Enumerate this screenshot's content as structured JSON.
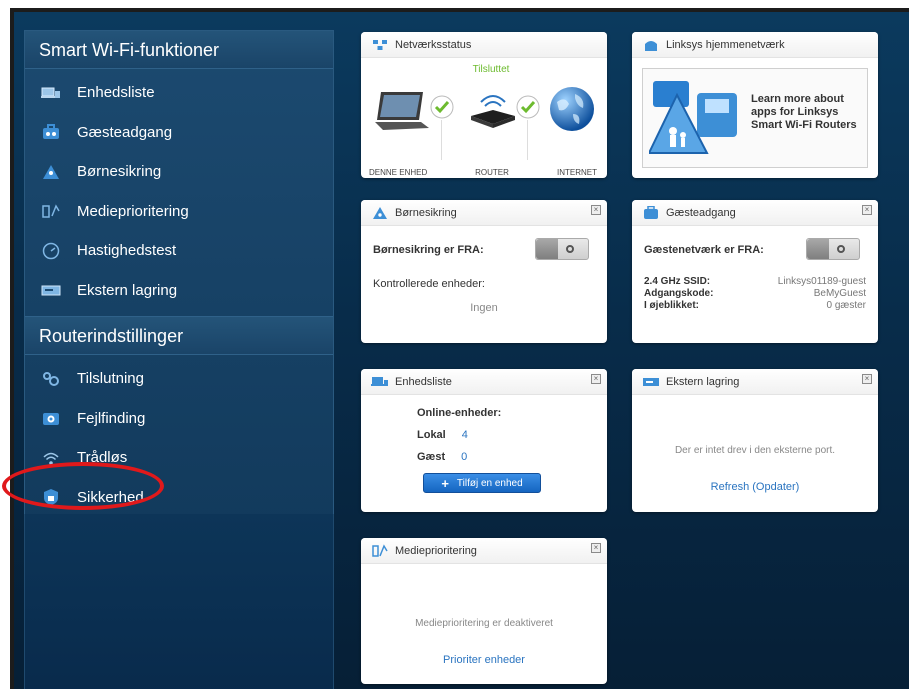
{
  "sidebar": {
    "smart_header": "Smart Wi-Fi-funktioner",
    "smart_items": [
      {
        "label": "Enhedsliste"
      },
      {
        "label": "Gæsteadgang"
      },
      {
        "label": "Børnesikring"
      },
      {
        "label": "Medieprioritering"
      },
      {
        "label": "Hastighedstest"
      },
      {
        "label": "Ekstern lagring"
      }
    ],
    "router_header": "Routerindstillinger",
    "router_items": [
      {
        "label": "Tilslutning"
      },
      {
        "label": "Fejlfinding"
      },
      {
        "label": "Trådløs"
      },
      {
        "label": "Sikkerhed"
      }
    ]
  },
  "network_status": {
    "title": "Netværksstatus",
    "connected_label": "Tilsluttet",
    "device_label": "DENNE ENHED",
    "router_label": "ROUTER",
    "internet_label": "INTERNET"
  },
  "home_network": {
    "title": "Linksys hjemmenetværk",
    "promo_line1": "Learn more about",
    "promo_line2": "apps for Linksys",
    "promo_line3": "Smart Wi-Fi Routers"
  },
  "parental": {
    "title": "Børnesikring",
    "status": "Børnesikring er FRA:",
    "controlled_label": "Kontrollerede enheder:",
    "controlled_value": "Ingen"
  },
  "guest": {
    "title": "Gæsteadgang",
    "status": "Gæstenetværk er FRA:",
    "ssid_label": "2.4 GHz SSID:",
    "ssid_value": "Linksys01189-guest",
    "password_label": "Adgangskode:",
    "password_value": "BeMyGuest",
    "current_label": "I øjeblikket:",
    "current_value": "0 gæster"
  },
  "device_list": {
    "title": "Enhedsliste",
    "online_label": "Online-enheder:",
    "local_label": "Lokal",
    "local_value": "4",
    "guest_label": "Gæst",
    "guest_value": "0",
    "add_button": "Tilføj en enhed"
  },
  "storage": {
    "title": "Ekstern lagring",
    "message": "Der er intet drev i den eksterne port.",
    "refresh": "Refresh (Opdater)"
  },
  "media": {
    "title": "Medieprioritering",
    "message": "Medieprioritering er deaktiveret",
    "link": "Prioriter enheder"
  },
  "colors": {
    "accent_green": "#6dbb2f",
    "link_blue": "#2a74c0",
    "highlight_red": "#e0191b"
  }
}
